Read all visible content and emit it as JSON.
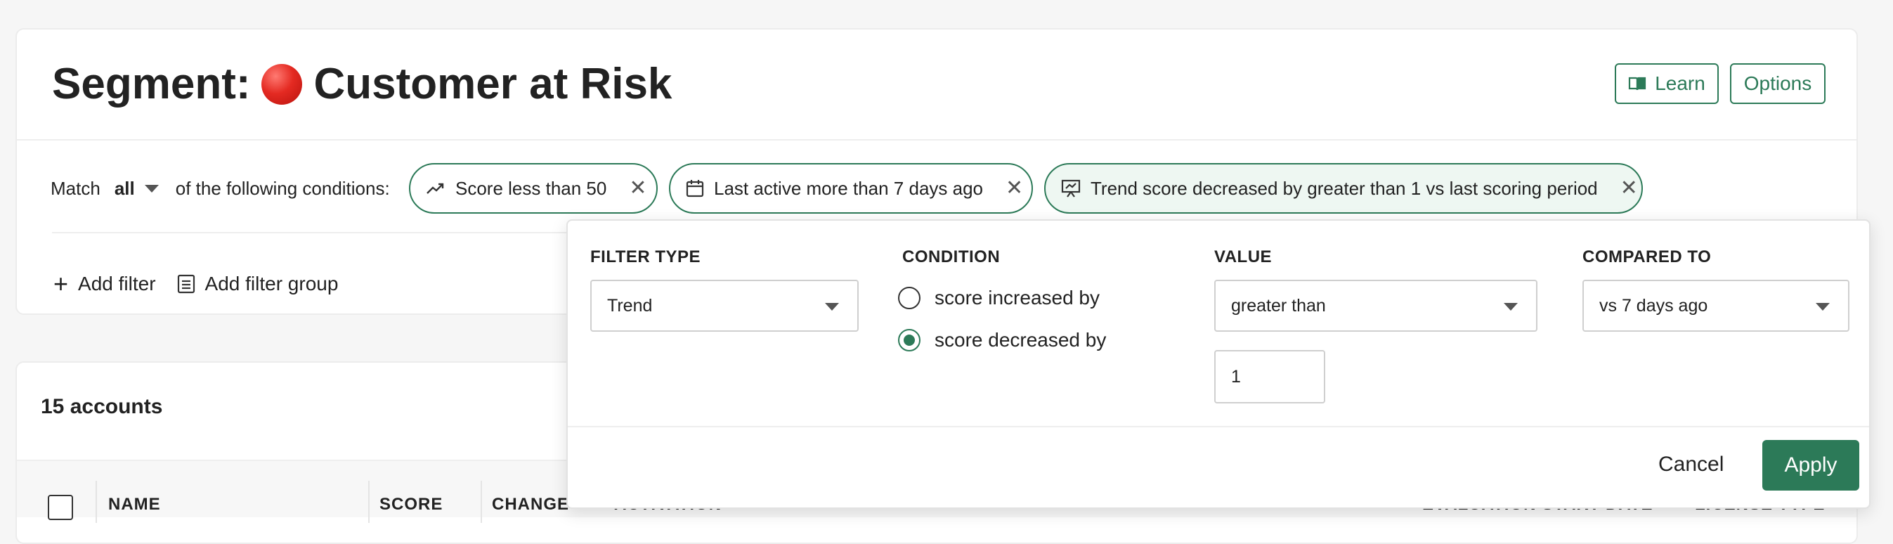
{
  "segment": {
    "title_prefix": "Segment:",
    "title_name": "Customer at Risk",
    "learn_label": "Learn",
    "options_label": "Options"
  },
  "filters": {
    "match_label": "Match",
    "match_value": "all",
    "following_label": "of the following conditions:",
    "pills": [
      {
        "label": "Score less than 50",
        "icon": "trend-up-icon"
      },
      {
        "label": "Last active more than 7 days ago",
        "icon": "calendar-icon"
      },
      {
        "label": "Trend score decreased by greater than 1 vs last scoring period",
        "icon": "presentation-chart-icon"
      }
    ],
    "add_filter_label": "Add filter",
    "add_filter_group_label": "Add filter group"
  },
  "accounts": {
    "count_label": "15 accounts",
    "columns": [
      "NAME",
      "SCORE",
      "CHANGE",
      "ACTIVATION",
      "EVALUATION START DATE",
      "LICENSE TYPE"
    ]
  },
  "popover": {
    "filter_type_label": "FILTER TYPE",
    "filter_type_value": "Trend",
    "condition_label": "CONDITION",
    "conditions": [
      {
        "label": "score increased by",
        "checked": false
      },
      {
        "label": "score decreased by",
        "checked": true
      }
    ],
    "value_label": "VALUE",
    "value_operator": "greater than",
    "value_amount": "1",
    "compared_label": "COMPARED TO",
    "compared_value": "vs 7 days ago",
    "cancel_label": "Cancel",
    "apply_label": "Apply"
  },
  "colors": {
    "accent": "#2c7a58",
    "danger_dot": "#e42a22"
  }
}
